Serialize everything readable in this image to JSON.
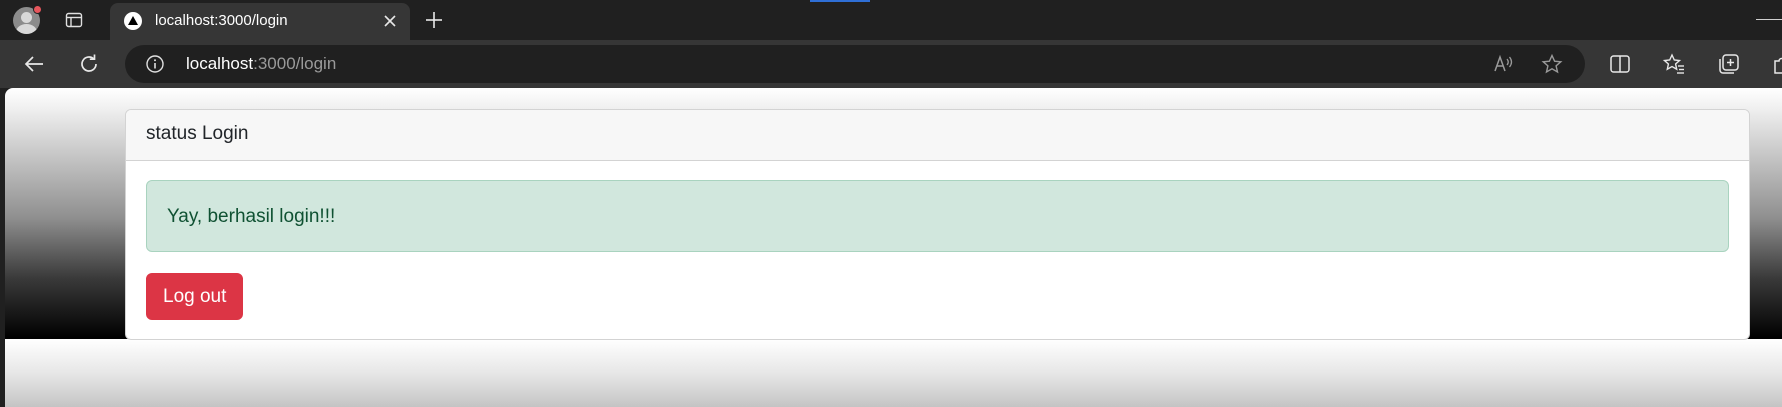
{
  "browser": {
    "tab": {
      "title": "localhost:3000/login",
      "favicon": "nextjs-triangle-icon"
    },
    "address": {
      "host": "localhost",
      "path": ":3000/login"
    },
    "accent_color": "#2f6fd6",
    "icons": [
      "profile-avatar-icon",
      "tab-actions-icon",
      "close-icon",
      "new-tab-icon",
      "back-icon",
      "refresh-icon",
      "info-icon",
      "read-aloud-icon",
      "favorite-star-icon",
      "split-screen-icon",
      "favorites-icon",
      "collections-icon",
      "extensions-icon",
      "minimize-icon"
    ]
  },
  "page": {
    "card": {
      "header": "status Login",
      "alert": {
        "message": "Yay, berhasil login!!!",
        "color": "#d1e7dd"
      },
      "logout_button": {
        "label": "Log out",
        "color": "#dc3545"
      }
    }
  }
}
